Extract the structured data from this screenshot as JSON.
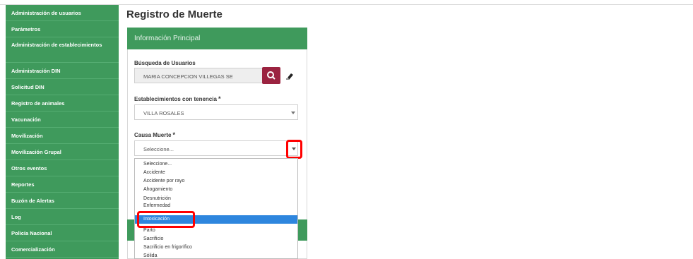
{
  "sidebar": {
    "items": [
      {
        "label": "Administración de usuarios"
      },
      {
        "label": "Parámetros"
      },
      {
        "label": "Administración de establecimientos"
      },
      {
        "label": "Administración DIN"
      },
      {
        "label": "Solicitud DIN"
      },
      {
        "label": "Registro de animales"
      },
      {
        "label": "Vacunación"
      },
      {
        "label": "Movilización"
      },
      {
        "label": "Movilización Grupal"
      },
      {
        "label": "Otros eventos"
      },
      {
        "label": "Reportes"
      },
      {
        "label": "Buzón de Alertas"
      },
      {
        "label": "Log"
      },
      {
        "label": "Policía Nacional"
      },
      {
        "label": "Comercialización"
      }
    ]
  },
  "main": {
    "title": "Registro de Muerte",
    "panel_title": "Información Principal",
    "user_search": {
      "label": "Búsqueda de Usuarios",
      "value": "MARIA CONCEPCION VILLEGAS SE"
    },
    "establishment": {
      "label": "Establecimientos con tenencia",
      "required_mark": "*",
      "value": "VILLA ROSALES"
    },
    "cause": {
      "label": "Causa Muerte",
      "required_mark": "*",
      "value": "Seleccione...",
      "options": [
        "Seleccione...",
        "Accidente",
        "Accidente por rayo",
        "Ahogamiento",
        "Desnutrición",
        "Enfermedad",
        "Intoxicación",
        "Parto",
        "Sacrificio",
        "Sacrificio en frigorífico",
        "Sólida"
      ],
      "selected_option": "Intoxicación"
    }
  },
  "icons": {
    "search": "search-icon",
    "eraser": "eraser-icon",
    "caret": "chevron-down-icon"
  },
  "colors": {
    "brand_green": "#3f9a5c",
    "search_button": "#9b2340",
    "highlight": "#ff0000",
    "selected_option": "#2e86de"
  }
}
